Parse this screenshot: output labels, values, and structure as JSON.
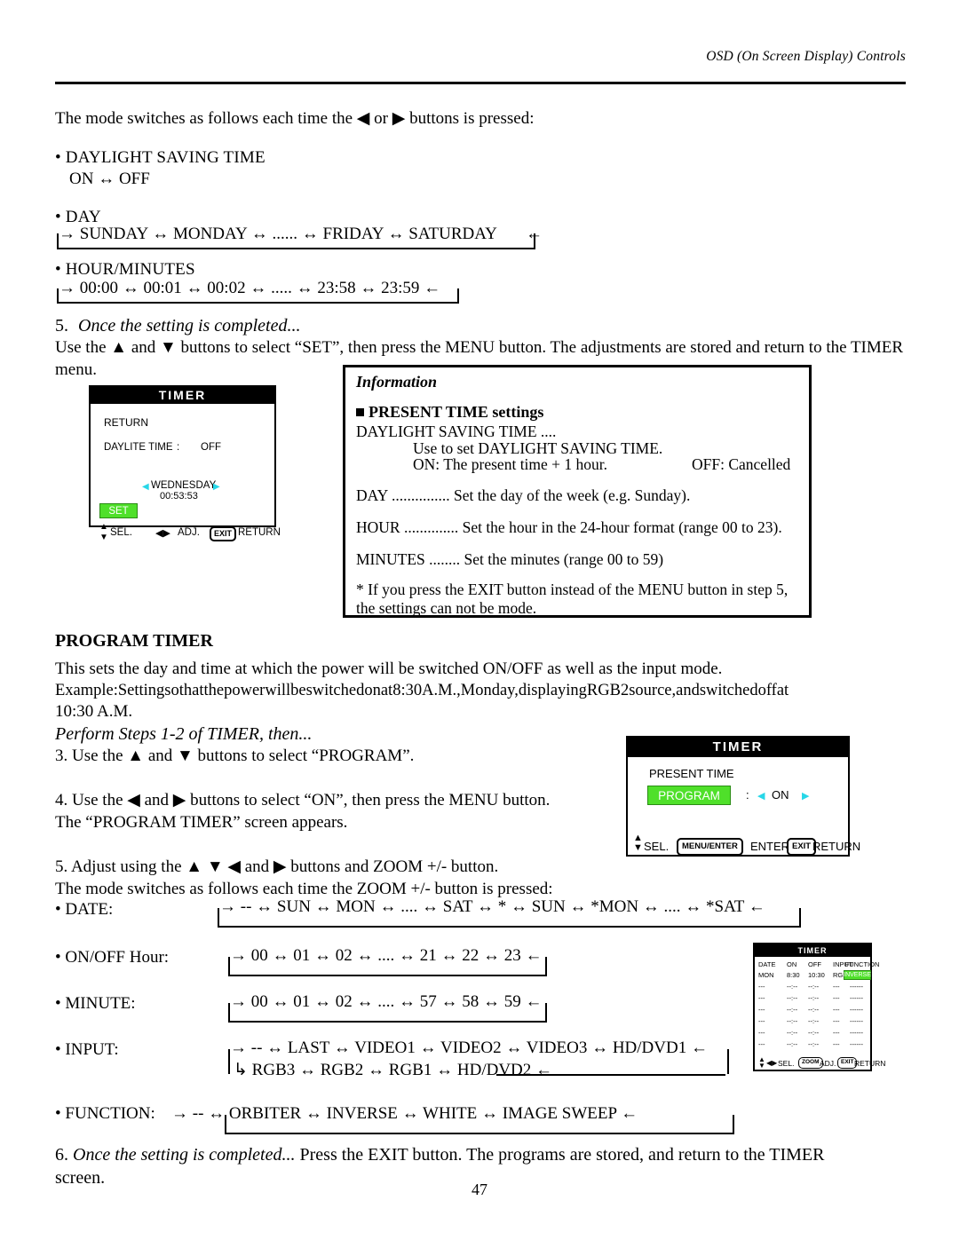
{
  "header": {
    "running_head": "OSD (On Screen Display) Controls"
  },
  "intro": {
    "line": "The mode switches as follows each time the ◀ or ▶ buttons is pressed:"
  },
  "mode_lists": [
    {
      "bullet_label": "• DAYLIGHT SAVING TIME",
      "chain": "ON ↔ OFF",
      "looped": false
    },
    {
      "bullet_label": "• DAY",
      "chain": "→ SUNDAY ↔ MONDAY ↔ ...... ↔ FRIDAY ↔ SATURDAY",
      "looped": true
    },
    {
      "bullet_label": "• HOUR/MINUTES",
      "chain": "→ 00:00 ↔ 00:01 ↔ 00:02 ↔ ..... ↔ 23:58 ↔ 23:59 ←",
      "looped": true
    }
  ],
  "step5": {
    "number": "5.",
    "title": "Once the setting is completed...",
    "body": "Use the ▲ and ▼ buttons to select “SET”, then press the MENU button. The adjustments are stored and return to the TIMER menu."
  },
  "osd_timer_present": {
    "title": "TIMER",
    "return_label": "RETURN",
    "daylite_label": "DAYLITE TIME",
    "daylite_colon": ":",
    "daylite_value": "OFF",
    "left_arrow": "◀",
    "right_arrow": "▶",
    "day_value": "WEDNESDAY",
    "time_value": "00:53:53",
    "set_button": "SET",
    "foot_sel": "SEL.",
    "foot_adj": "ADJ.",
    "foot_exit_key": "EXIT",
    "foot_return": "RETURN"
  },
  "information": {
    "title": "Information",
    "heading": "PRESENT TIME settings",
    "lines": [
      "DAYLIGHT SAVING TIME ....",
      "Use to set DAYLIGHT SAVING TIME.",
      "ON: The present time + 1 hour.",
      "OFF: Cancelled",
      "DAY ............... Set the day of the week (e.g. Sunday).",
      "HOUR .............. Set the hour in the 24-hour format (range 00 to 23).",
      "MINUTES ........ Set the minutes (range 00 to 59)"
    ],
    "note": "* If you press the EXIT button instead of the MENU button in step 5, the settings can not be mode."
  },
  "program_timer": {
    "heading": "PROGRAM TIMER",
    "desc1": "This sets the day and time at which the power will be switched ON/OFF as well as the input mode.",
    "desc2": "Example:Settingsothatthepowerwillbeswitchedonat8:30A.M.,Monday,displayingRGB2source,andswitchedoffat",
    "desc3": "10:30 A.M.",
    "perform": "Perform Steps 1-2 of TIMER, then...",
    "step3": "3. Use the ▲ and ▼ buttons to select “PROGRAM”.",
    "step4_a": "4. Use the ◀ and ▶ buttons to select “ON”, then press the MENU button.",
    "step4_b": "The “PROGRAM TIMER” screen appears.",
    "step5_a": "5. Adjust using the ▲ ▼ ◀ and ▶ buttons and ZOOM +/- button.",
    "step5_b": "The mode switches as follows each time the ZOOM +/- button is pressed:"
  },
  "osd_timer_program": {
    "title": "TIMER",
    "present_time": "PRESENT TIME",
    "program_button": "PROGRAM",
    "colon": ":",
    "left_arrow": "◀",
    "value": "ON",
    "right_arrow": "▶",
    "foot_sel": "SEL.",
    "foot_menu_key": "MENU/ENTER",
    "foot_enter": "ENTER",
    "foot_exit_key": "EXIT",
    "foot_return": "RETURN"
  },
  "osd_program_table": {
    "title": "TIMER",
    "columns": [
      "DATE",
      "ON",
      "OFF",
      "INPUT",
      "FUNCTION"
    ],
    "rows": [
      {
        "date": "MON",
        "on": "8:30",
        "off": "10:30",
        "input": "RGB2",
        "function": "INVERSE",
        "highlight": true
      },
      {
        "date": "---",
        "on": "--:--",
        "off": "--:--",
        "input": "---",
        "function": "------",
        "highlight": false
      },
      {
        "date": "---",
        "on": "--:--",
        "off": "--:--",
        "input": "---",
        "function": "------",
        "highlight": false
      },
      {
        "date": "---",
        "on": "--:--",
        "off": "--:--",
        "input": "---",
        "function": "------",
        "highlight": false
      },
      {
        "date": "---",
        "on": "--:--",
        "off": "--:--",
        "input": "---",
        "function": "------",
        "highlight": false
      },
      {
        "date": "---",
        "on": "--:--",
        "off": "--:--",
        "input": "---",
        "function": "------",
        "highlight": false
      },
      {
        "date": "---",
        "on": "--:--",
        "off": "--:--",
        "input": "---",
        "function": "------",
        "highlight": false
      }
    ],
    "foot_sel": "SEL.",
    "foot_zoom_key": "ZOOM",
    "foot_adj": "ADJ.",
    "foot_exit_key": "EXIT",
    "foot_return": "RETURN"
  },
  "program_modes": [
    {
      "label": "• DATE:",
      "chain": "→ -- ↔ SUN ↔ MON ↔ .... ↔ SAT ↔ * ↔ SUN ↔ *MON  ↔ .... ↔ *SAT ←"
    },
    {
      "label": "• ON/OFF Hour:",
      "chain": "→ 00 ↔ 01 ↔ 02 ↔ .... ↔ 21 ↔ 22 ↔ 23 ←"
    },
    {
      "label": "• MINUTE:",
      "chain": "→ 00 ↔ 01 ↔ 02 ↔ .... ↔ 57 ↔ 58 ↔ 59 ←"
    },
    {
      "label": "• INPUT:",
      "chain": "→ -- ↔ LAST ↔ VIDEO1 ↔ VIDEO2 ↔ VIDEO3 ↔ HD/DVD1 ←",
      "chain2": "↳ RGB3 ↔ RGB2 ↔ RGB1 ↔ HD/DVD2 ←"
    },
    {
      "label": "• FUNCTION:",
      "chain": "→ -- ↔ ORBITER ↔ INVERSE ↔ WHITE ↔ IMAGE SWEEP ←"
    }
  ],
  "step6": {
    "text_a": "6. ",
    "text_it": "Once the setting is completed...",
    "text_b": " Press the EXIT button. The programs are stored, and return to the TIMER",
    "text_c": "screen."
  },
  "page_number": "47",
  "colors": {
    "osd_highlight_green": "#4fe02a",
    "osd_arrow_cyan": "#27d7e8",
    "osd_title_bg": "#000000"
  }
}
